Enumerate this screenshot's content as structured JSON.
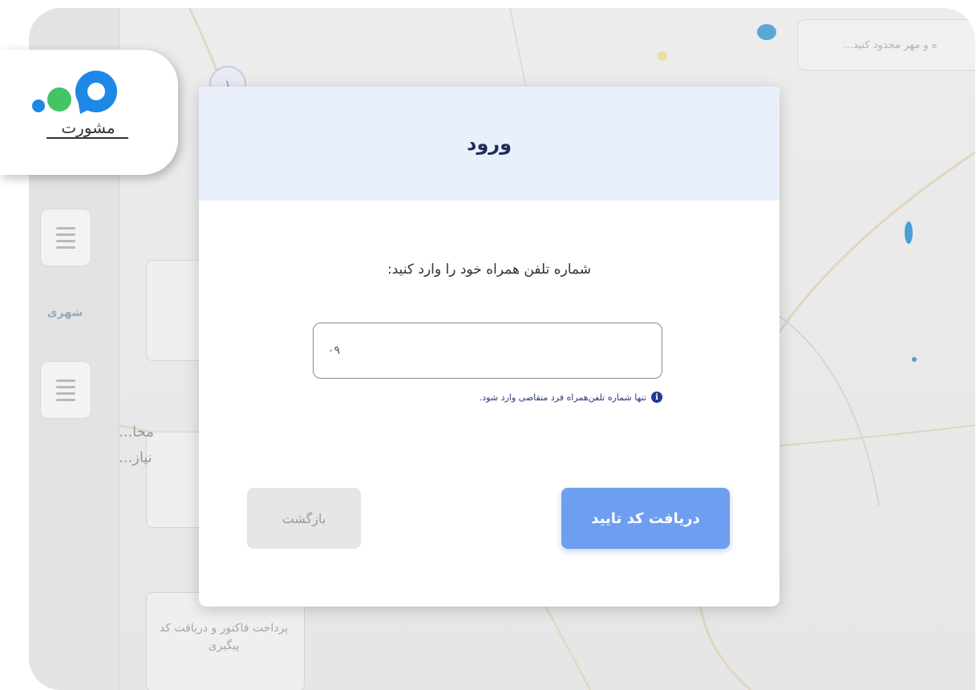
{
  "modal": {
    "title": "ورود",
    "prompt": "شماره تلفن همراه خود را وارد کنید:",
    "phone_input_value": "۰۹",
    "hint": "تنها شماره تلفن‌همراه فرد متقاضی وارد شود.",
    "back_label": "بازگشت",
    "confirm_label": "دریافت کد تایید"
  },
  "background": {
    "side_label": "شهری",
    "step_number": "۱",
    "top_pill_text": "...ه و مهر محدود کنید",
    "card_text": "پرداخت فاکتور و دریافت کد پیگیری",
    "side_text_1": "...محا",
    "side_text_2": "...نیاز"
  },
  "logo": {
    "brand_text": "مشورت"
  },
  "colors": {
    "accent": "#6e9ef0",
    "header_bg": "#eaf0fb",
    "title": "#1f2d5a",
    "logo_blue": "#1e88e5",
    "logo_green": "#43c465"
  }
}
